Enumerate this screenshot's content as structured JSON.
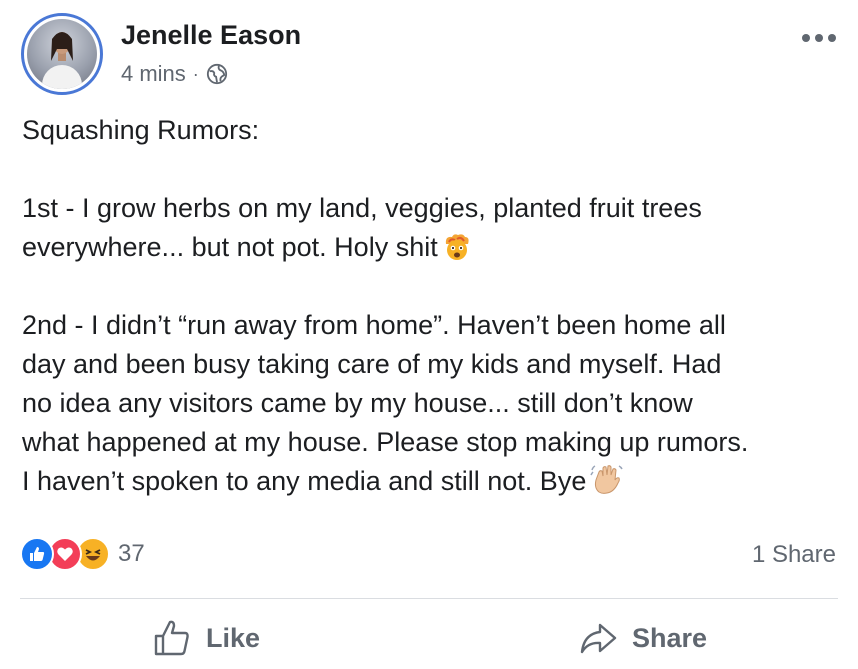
{
  "post": {
    "author": "Jenelle Eason",
    "timestamp": "4 mins",
    "separator": "·",
    "privacy_icon": "globe-icon",
    "more_icon": "more-options-icon",
    "lines": {
      "heading": "Squashing Rumors:",
      "p1_line1": "1st - I grow herbs on my land, veggies, planted fruit trees",
      "p1_line2": "everywhere... but not pot. Holy shit",
      "p2_line1": "2nd - I didn’t “run away from home”. Haven’t been home all",
      "p2_line2": "day and been busy taking care of my kids and myself. Had",
      "p2_line3": "no idea any visitors came by my house... still don’t know",
      "p2_line4": "what happened at my house. Please stop making up rumors.",
      "p2_line5": "I haven’t spoken to any media and still not. Bye"
    },
    "emojis": [
      "exploding-head-emoji",
      "waving-hand-emoji"
    ]
  },
  "reactions": {
    "types": [
      "like",
      "love",
      "haha"
    ],
    "count": "37",
    "shares": "1 Share"
  },
  "actions": {
    "like_label": "Like",
    "share_label": "Share"
  },
  "colors": {
    "text": "#1c1e21",
    "secondary": "#606770",
    "like_blue": "#1877f2",
    "love_red": "#f33e58",
    "haha_yellow": "#f7b125",
    "avatar_ring": "#4a78d6"
  }
}
